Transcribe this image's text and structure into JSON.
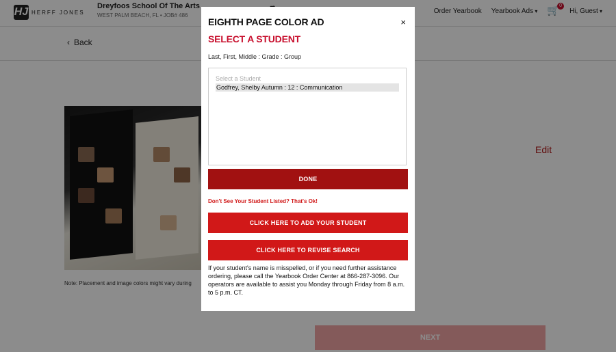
{
  "header": {
    "logo_text": "HERFF JONES",
    "logo_mark": "HJ",
    "school_name": "Dreyfoos School Of The Arts",
    "school_location": "WEST PALM BEACH, FL • JOB# 486",
    "nav": {
      "order_yearbook": "Order Yearbook",
      "yearbook_ads": "Yearbook Ads",
      "cart_count": "0",
      "greeting": "Hi, Guest"
    }
  },
  "page": {
    "back_label": "Back",
    "note": "Note: Placement and image colors might vary during",
    "edit_label": "Edit",
    "next_label": "NEXT"
  },
  "modal": {
    "title": "EIGHTH PAGE COLOR AD",
    "close_label": "×",
    "subtitle": "SELECT A STUDENT",
    "format_hint": "Last, First, Middle : Grade : Group",
    "list_placeholder": "Select a Student",
    "students": [
      "Godfrey, Shelby Autumn : 12 : Communication"
    ],
    "done_label": "DONE",
    "missing_text": "Don't See Your Student Listed? That's Ok!",
    "add_label": "CLICK HERE TO ADD YOUR STUDENT",
    "revise_label": "CLICK HERE TO REVISE SEARCH",
    "help_text": "If your student's name is misspelled, or if you need further assistance ordering, please call the Yearbook Order Center at 866-287-3096. Our operators are available to assist you Monday through Friday from 8 a.m. to 5 p.m. CT."
  },
  "colors": {
    "accent": "#d11818",
    "accent_dark": "#a11111",
    "next_disabled": "#f0a5a5"
  }
}
